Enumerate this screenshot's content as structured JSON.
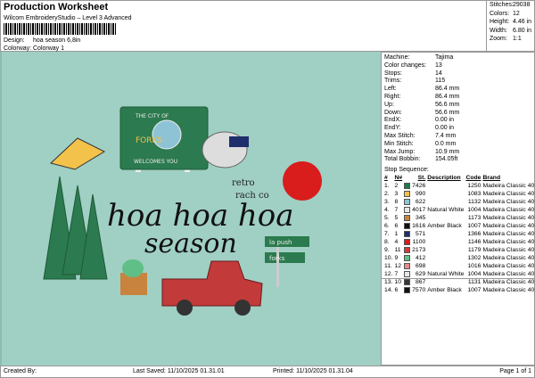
{
  "header": {
    "title": "Production Worksheet",
    "subtitle": "Wilcom EmbroideryStudio – Level 3 Advanced",
    "design_label": "Design:",
    "design_value": "hoa season 6,8in",
    "colorway_label": "Colorway:",
    "colorway_value": "Colorway 1"
  },
  "stats": [
    {
      "k": "Stitches:",
      "v": "29038"
    },
    {
      "k": "Colors:",
      "v": "12"
    },
    {
      "k": "Height:",
      "v": "4.46 in"
    },
    {
      "k": "Width:",
      "v": "6.80 in"
    },
    {
      "k": "Zoom:",
      "v": "1:1"
    }
  ],
  "info": [
    {
      "k": "Machine:",
      "v": "Tajima"
    },
    {
      "k": "Color changes:",
      "v": "13"
    },
    {
      "k": "Stops:",
      "v": "14"
    },
    {
      "k": "Trims:",
      "v": "115"
    },
    {
      "k": "Left:",
      "v": "86.4 mm"
    },
    {
      "k": "Right:",
      "v": "86.4 mm"
    },
    {
      "k": "Up:",
      "v": "56.6 mm"
    },
    {
      "k": "Down:",
      "v": "56.6 mm"
    },
    {
      "k": "EndX:",
      "v": "0.00 in"
    },
    {
      "k": "EndY:",
      "v": "0.00 in"
    },
    {
      "k": "Max Stitch:",
      "v": "7.4 mm"
    },
    {
      "k": "Min Stitch:",
      "v": "0.0 mm"
    },
    {
      "k": "Max Jump:",
      "v": "10.9 mm"
    },
    {
      "k": "Total Bobbin:",
      "v": "154.05ft"
    }
  ],
  "sequence": {
    "title": "Stop Sequence:",
    "columns": [
      "#",
      "N#",
      "St.",
      "Description",
      "Code",
      "Brand"
    ],
    "rows": [
      [
        "1.",
        "2",
        "#1e7a4a",
        "7426",
        "",
        "1250",
        "Madeira Classic 40"
      ],
      [
        "2.",
        "3",
        "#f2c24a",
        "990",
        "",
        "1083",
        "Madeira Classic 40"
      ],
      [
        "3.",
        "8",
        "#8ec3d6",
        "622",
        "",
        "1132",
        "Madeira Classic 40"
      ],
      [
        "4.",
        "7",
        "#e8e8e8",
        "4017",
        "Natural White",
        "1004",
        "Madeira Classic 40"
      ],
      [
        "5.",
        "5",
        "#c8843e",
        "345",
        "",
        "1173",
        "Madeira Classic 40"
      ],
      [
        "6.",
        "6",
        "#111111",
        "1616",
        "Amber Black",
        "1007",
        "Madeira Classic 40"
      ],
      [
        "7.",
        "1",
        "#1f2f6b",
        "571",
        "",
        "1366",
        "Madeira Classic 40"
      ],
      [
        "8.",
        "4",
        "#d91c1c",
        "1100",
        "",
        "1146",
        "Madeira Classic 40"
      ],
      [
        "9.",
        "11",
        "#d23a3a",
        "2173",
        "",
        "1179",
        "Madeira Classic 40"
      ],
      [
        "10.",
        "9",
        "#5fbf86",
        "412",
        "",
        "1302",
        "Madeira Classic 40"
      ],
      [
        "11.",
        "12",
        "#e88a8a",
        "698",
        "",
        "1016",
        "Madeira Classic 40"
      ],
      [
        "12.",
        "7",
        "#e8e8e8",
        "629",
        "Natural White",
        "1004",
        "Madeira Classic 40"
      ],
      [
        "13.",
        "10",
        "#3a3430",
        "867",
        "",
        "1131",
        "Madeira Classic 40"
      ],
      [
        "14.",
        "6",
        "#111111",
        "7570",
        "Amber Black",
        "1007",
        "Madeira Classic 40"
      ]
    ]
  },
  "design": {
    "sign_top": "THE CITY OF",
    "sign_mid": "FORKS",
    "sign_bottom": "WELCOMES YOU",
    "line1": "hoa hoa hoa",
    "line2": "season",
    "retro1": "retro",
    "retro2": "rach co",
    "road1": "la push",
    "road2": "forks"
  },
  "footer": {
    "created": "Created By:",
    "saved": "Last Saved: 11/10/2025 01.31.01",
    "printed": "Printed: 11/10/2025 01.31.04",
    "page": "Page 1 of 1"
  }
}
